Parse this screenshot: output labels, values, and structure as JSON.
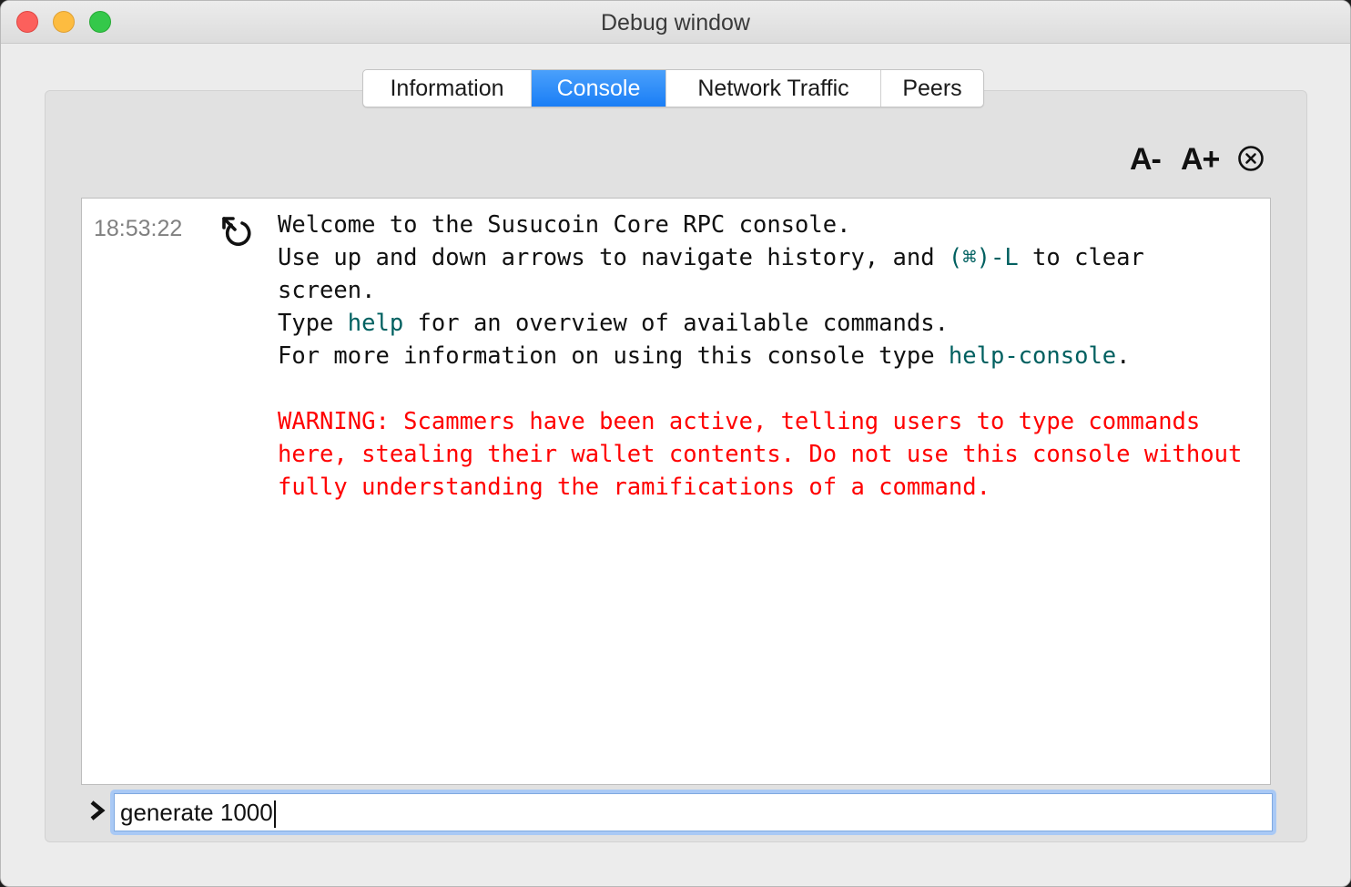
{
  "window": {
    "title": "Debug window"
  },
  "tabs": [
    {
      "label": "Information",
      "active": false
    },
    {
      "label": "Console",
      "active": true
    },
    {
      "label": "Network Traffic",
      "active": false
    },
    {
      "label": "Peers",
      "active": false
    }
  ],
  "toolbar": {
    "font_smaller_label": "A-",
    "font_larger_label": "A+",
    "clear_icon": "clear-circle-x-icon"
  },
  "console": {
    "timestamp": "18:53:22",
    "message_icon": "reply-arrow-icon",
    "lines": {
      "l1": "Welcome to the Susucoin Core RPC console.",
      "l2a": "Use up and down arrows to navigate history, and ",
      "l2_cmd": "(⌘)-L",
      "l2b": " to clear",
      "l3": "screen.",
      "l4a": "Type ",
      "l4_cmd": "help",
      "l4b": " for an overview of available commands.",
      "l5a": "For more information on using this console type ",
      "l5_cmd": "help-console",
      "l5b": ".",
      "w1": "WARNING: Scammers have been active, telling users to type commands",
      "w2": "here, stealing their wallet contents. Do not use this console without",
      "w3": "fully understanding the ramifications of a command."
    }
  },
  "input": {
    "prompt_icon": "chevron-right-icon",
    "value": "generate 1000"
  },
  "colors": {
    "tab_active": "#1a7ef6",
    "command_text": "#006060",
    "warning_text": "#ff0000",
    "timestamp_text": "#808080"
  }
}
